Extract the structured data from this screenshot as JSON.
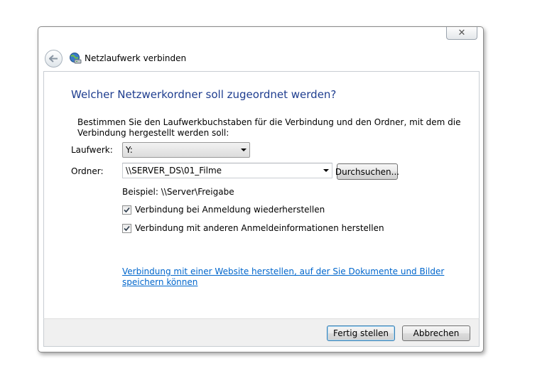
{
  "window": {
    "title": "Netzlaufwerk verbinden",
    "close_glyph": "✕",
    "back_glyph": "←"
  },
  "dialog": {
    "heading": "Welcher Netzwerkordner soll zugeordnet werden?",
    "description": "Bestimmen Sie den Laufwerkbuchstaben für die Verbindung und den Ordner, mit dem die Verbindung hergestellt werden soll:",
    "drive_label": "Laufwerk:",
    "drive_value": "Y:",
    "folder_label": "Ordner:",
    "folder_value": "\\\\SERVER_DS\\01_Filme",
    "browse_label": "Durchsuchen...",
    "example": "Beispiel: \\\\Server\\Freigabe",
    "checkbox_reconnect": {
      "label": "Verbindung bei Anmeldung wiederherstellen",
      "checked": true
    },
    "checkbox_credentials": {
      "label": "Verbindung mit anderen Anmeldeinformationen herstellen",
      "checked": true
    },
    "website_link": "Verbindung mit einer Website herstellen, auf der Sie Dokumente und Bilder speichern können"
  },
  "footer": {
    "finish_label": "Fertig stellen",
    "cancel_label": "Abbrechen"
  },
  "colors": {
    "heading": "#1e3d8f",
    "link": "#0066cc",
    "footer_bg": "#f0f0f0"
  },
  "icons": {
    "back": "back-arrow-icon",
    "title": "network-drive-icon",
    "close": "close-icon",
    "dropdown": "chevron-down-icon",
    "check": "checkmark-icon"
  }
}
